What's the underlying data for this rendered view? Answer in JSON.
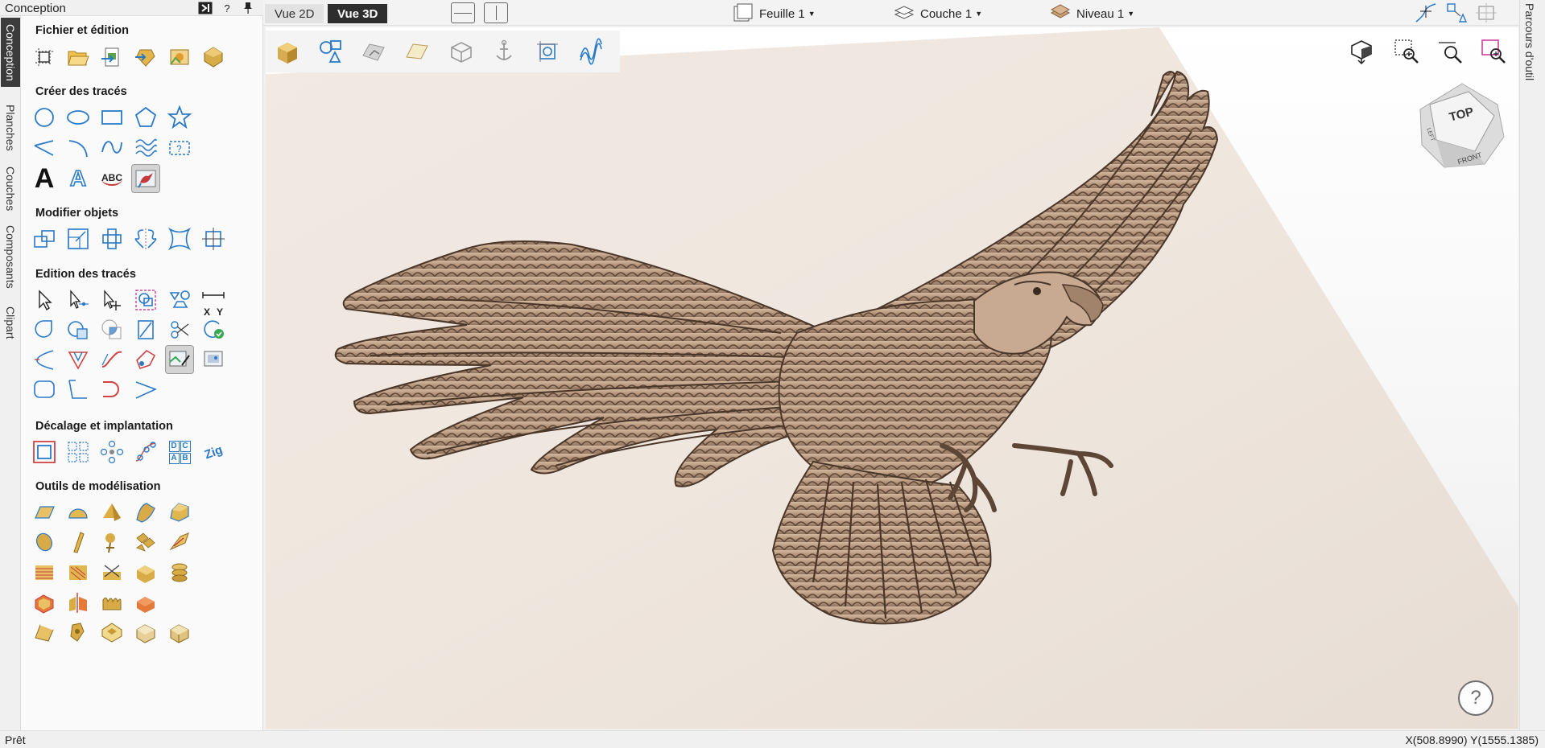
{
  "panel": {
    "title": "Conception",
    "header_buttons": [
      "expand-icon",
      "help",
      "pin-icon"
    ],
    "help_label": "?"
  },
  "vertical_tabs": [
    {
      "label": "Conception",
      "active": true
    },
    {
      "label": "Planches",
      "active": false
    },
    {
      "label": "Couches",
      "active": false
    },
    {
      "label": "Composants",
      "active": false
    },
    {
      "label": "Clipart",
      "active": false
    }
  ],
  "sections": [
    {
      "title": "Fichier et édition"
    },
    {
      "title": "Créer des tracés"
    },
    {
      "title": "Modifier objets"
    },
    {
      "title": "Edition des tracés"
    },
    {
      "title": "Décalage et implantation"
    },
    {
      "title": "Outils de modélisation"
    }
  ],
  "text_tools": {
    "big_a": "A",
    "outline_a": "A",
    "arc_text": "ABC"
  },
  "edit_tools": {
    "x_label": "X",
    "y_label": "Y"
  },
  "offset_tools": {
    "nest_text": "D C A B",
    "nest_letters": [
      "D",
      "C",
      "A",
      "B"
    ],
    "curved_text": "Zig"
  },
  "topbar": {
    "view_2d": "Vue 2D",
    "view_3d": "Vue 3D",
    "sheet": "Feuille 1",
    "layer": "Couche 1",
    "level": "Niveau 1"
  },
  "right_tab": {
    "label": "Parcours d'outil"
  },
  "view_cube": {
    "top": "TOP",
    "front": "FRONT",
    "left": "LEFT"
  },
  "help_button": "?",
  "status": {
    "left": "Prêt",
    "coords": "X(508.8990) Y(1555.1385)"
  },
  "colors": {
    "accent_blue": "#2a79c8",
    "relief_bronze": "#b7977d",
    "dark_tab": "#3c3c3c"
  }
}
